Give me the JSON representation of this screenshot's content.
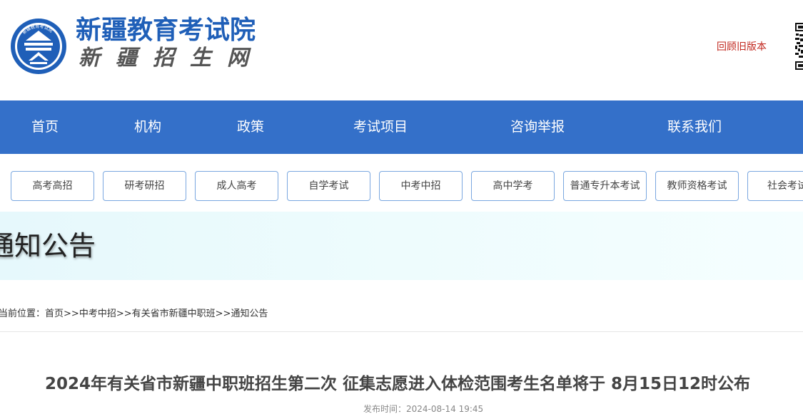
{
  "header": {
    "site_name": "新疆教育考试院",
    "site_sub": "新疆招生网",
    "logo_text": "新疆教育考试院",
    "old_version_link": "回顾旧版本"
  },
  "nav": {
    "items": [
      {
        "label": "首页"
      },
      {
        "label": "机构"
      },
      {
        "label": "政策"
      },
      {
        "label": "考试项目"
      },
      {
        "label": "咨询举报"
      },
      {
        "label": "联系我们"
      }
    ]
  },
  "categories": [
    {
      "label": "高考高招"
    },
    {
      "label": "研考研招"
    },
    {
      "label": "成人高考"
    },
    {
      "label": "自学考试"
    },
    {
      "label": "中考中招"
    },
    {
      "label": "高中学考"
    },
    {
      "label": "普通专升本考试"
    },
    {
      "label": "教师资格考试"
    },
    {
      "label": "社会考试"
    }
  ],
  "banner": {
    "title": "通知公告"
  },
  "breadcrumb": {
    "prefix": "当前位置：",
    "items": [
      "首页",
      "中考中招",
      "有关省市新疆中职班",
      "通知公告"
    ],
    "separator": ">>"
  },
  "article": {
    "title": "2024年有关省市新疆中职班招生第二次 征集志愿进入体检范围考生名单将于 8月15日12时公布",
    "publish_label": "发布时间：",
    "publish_time": "2024-08-14 19:45"
  },
  "colors": {
    "brand_blue": "#3470c9",
    "title_blue": "#1f5fb8",
    "link_red": "#c2281f",
    "button_border": "#7aa7e0"
  }
}
